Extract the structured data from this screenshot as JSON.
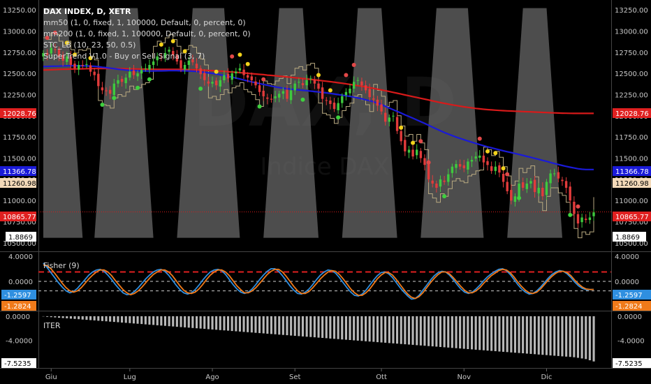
{
  "header": {
    "title": "DAX INDEX, D, XETR",
    "watermark_symbol": "DAX, D",
    "watermark_name": "Indice DAX"
  },
  "legend": {
    "mm50": "mm50 (1, 0, fixed, 1, 100000, Default, 0, percent, 0)",
    "mm200": "mm200 (1, 0, fixed, 1, 100000, Default, 0, percent, 0)",
    "stc": "STC_LB (10, 23, 50, 0.5)",
    "supertrend": "SuperTrend V1.0 - Buy or Sell Signal (3, 7)",
    "fisher": "Fisher (9)",
    "iter": "ITER"
  },
  "colors": {
    "background": "#000000",
    "candle_up": "#3ec93e",
    "candle_down": "#e23b3b",
    "ma50": "#1a1ad8",
    "ma200": "#d81a1a",
    "stc_fill": "#6e6e6e",
    "supertrend": "#b8a980",
    "fisher_main": "#2f8fe0",
    "fisher_signal": "#f07a1a",
    "fisher_dash_upper": "#e02020",
    "dot_yellow": "#f3d21a",
    "dot_red": "#e24848",
    "dot_green": "#3ed03e",
    "iter_bar": "#b8b8b8"
  },
  "badges": {
    "last_price": "10865.77",
    "ma200": "12028.76",
    "ma50": "11366.78",
    "supertrend": "11260.98",
    "stc": "1.8869",
    "fisher_main": "-1.2597",
    "fisher_signal": "-1.2824",
    "iter": "-7.5235"
  },
  "chart_data": [
    {
      "type": "candlestick",
      "title": "DAX INDEX, D, XETR",
      "x_tick_labels": [
        "Giu",
        "Lug",
        "Ago",
        "Set",
        "Ott",
        "Nov",
        "Dic"
      ],
      "y_tick_labels": [
        "13250.00",
        "13000.00",
        "12750.00",
        "12500.00",
        "12250.00",
        "12000.00",
        "11750.00",
        "11500.00",
        "11250.00",
        "11000.00",
        "10750.00",
        "10500.00"
      ],
      "ylim": [
        10450,
        13300
      ],
      "close": [
        12740,
        12720,
        12800,
        12780,
        12700,
        12650,
        12700,
        12600,
        12560,
        12600,
        12590,
        12610,
        12520,
        12480,
        12350,
        12300,
        12290,
        12260,
        12380,
        12420,
        12400,
        12450,
        12520,
        12480,
        12500,
        12540,
        12560,
        12600,
        12640,
        12700,
        12680,
        12740,
        12780,
        12720,
        12640,
        12560,
        12600,
        12650,
        12630,
        12560,
        12490,
        12420,
        12380,
        12400,
        12360,
        12420,
        12480,
        12440,
        12500,
        12520,
        12560,
        12480,
        12450,
        12420,
        12360,
        12280,
        12230,
        12200,
        12190,
        12230,
        12260,
        12290,
        12200,
        12300,
        12380,
        12400,
        12360,
        12420,
        12440,
        12380,
        12320,
        12200,
        12180,
        12140,
        12080,
        12150,
        12230,
        12280,
        12320,
        12400,
        12420,
        12360,
        12300,
        12220,
        12190,
        12120,
        12050,
        11930,
        11980,
        12000,
        11820,
        11700,
        11580,
        11600,
        11520,
        11600,
        11500,
        11420,
        11250,
        11200,
        11150,
        11250,
        11220,
        11310,
        11400,
        11430,
        11400,
        11380,
        11460,
        11480,
        11520,
        11530,
        11450,
        11420,
        11350,
        11400,
        11330,
        11220,
        11110,
        11000,
        11050,
        11200,
        11150,
        11200,
        11230,
        11100,
        11150,
        11050,
        11220,
        11320,
        11320,
        11260,
        11230,
        11150,
        11000,
        10840,
        10730,
        10800,
        10770,
        10800,
        10860
      ],
      "ma50": [
        12580,
        12582,
        12584,
        12585,
        12586,
        12588,
        12589,
        12590,
        12590,
        12590,
        12589,
        12588,
        12586,
        12583,
        12579,
        12573,
        12568,
        12562,
        12556,
        12550,
        12545,
        12540,
        12537,
        12534,
        12531,
        12530,
        12529,
        12528,
        12529,
        12530,
        12530,
        12531,
        12532,
        12532,
        12532,
        12531,
        12530,
        12529,
        12526,
        12523,
        12518,
        12512,
        12506,
        12500,
        12492,
        12484,
        12475,
        12466,
        12456,
        12445,
        12434,
        12422,
        12411,
        12400,
        12390,
        12380,
        12370,
        12360,
        12350,
        12341,
        12333,
        12326,
        12320,
        12314,
        12309,
        12305,
        12300,
        12296,
        12291,
        12286,
        12281,
        12275,
        12270,
        12264,
        12257,
        12250,
        12243,
        12236,
        12228,
        12219,
        12210,
        12200,
        12189,
        12178,
        12165,
        12150,
        12132,
        12112,
        12092,
        12072,
        12052,
        12032,
        12011,
        11991,
        11971,
        11951,
        11931,
        11910,
        11888,
        11866,
        11844,
        11823,
        11803,
        11784,
        11766,
        11749,
        11733,
        11718,
        11703,
        11688,
        11674,
        11660,
        11647,
        11634,
        11622,
        11610,
        11598,
        11587,
        11576,
        11566,
        11555,
        11544,
        11533,
        11521,
        11510,
        11498,
        11486,
        11474,
        11462,
        11449,
        11437,
        11425,
        11414,
        11403,
        11393,
        11384,
        11375,
        11369,
        11366,
        11366,
        11366
      ],
      "ma200": [
        12540,
        12541,
        12543,
        12545,
        12547,
        12549,
        12550,
        12551,
        12552,
        12553,
        12554,
        12555,
        12556,
        12557,
        12557,
        12557,
        12557,
        12557,
        12556,
        12556,
        12555,
        12554,
        12553,
        12553,
        12552,
        12551,
        12550,
        12550,
        12549,
        12548,
        12548,
        12548,
        12548,
        12548,
        12548,
        12547,
        12546,
        12545,
        12544,
        12542,
        12540,
        12538,
        12535,
        12533,
        12530,
        12527,
        12524,
        12520,
        12517,
        12513,
        12509,
        12505,
        12501,
        12497,
        12493,
        12489,
        12485,
        12480,
        12476,
        12472,
        12467,
        12463,
        12458,
        12454,
        12449,
        12444,
        12439,
        12434,
        12429,
        12424,
        12419,
        12413,
        12408,
        12402,
        12396,
        12390,
        12384,
        12377,
        12370,
        12363,
        12356,
        12348,
        12340,
        12332,
        12323,
        12314,
        12305,
        12296,
        12286,
        12276,
        12266,
        12256,
        12246,
        12236,
        12226,
        12216,
        12206,
        12196,
        12186,
        12176,
        12166,
        12156,
        12147,
        12138,
        12129,
        12121,
        12113,
        12106,
        12099,
        12093,
        12087,
        12082,
        12077,
        12073,
        12069,
        12066,
        12063,
        12060,
        12058,
        12056,
        12054,
        12052,
        12050,
        12048,
        12046,
        12044,
        12042,
        12040,
        12038,
        12036,
        12034,
        12032,
        12031,
        12030,
        12029,
        12028,
        12028,
        12028,
        12028,
        12028,
        12028
      ]
    },
    {
      "type": "line",
      "title": "Fisher (9)",
      "y_tick_labels": [
        "4.0000",
        "0.0000",
        "-4.0000"
      ],
      "ylim": [
        -4.3,
        4.2
      ],
      "reference_lines": [
        1.5,
        0,
        -1.5
      ],
      "series": [
        {
          "name": "Fisher",
          "values": [
            2.9,
            2.2,
            1.4,
            0.6,
            -0.2,
            -0.9,
            -1.5,
            -1.8,
            -1.6,
            -1.1,
            -0.4,
            0.3,
            1.0,
            1.5,
            1.8,
            1.9,
            1.6,
            1.0,
            0.3,
            -0.5,
            -1.2,
            -1.8,
            -2.1,
            -2.0,
            -1.6,
            -1.0,
            -0.3,
            0.4,
            1.0,
            1.5,
            1.8,
            1.9,
            1.6,
            1.0,
            0.2,
            -0.6,
            -1.3,
            -1.8,
            -2.0,
            -1.8,
            -1.3,
            -0.6,
            0.2,
            0.9,
            1.5,
            1.8,
            1.9,
            1.7,
            1.1,
            0.3,
            -0.5,
            -1.2,
            -1.7,
            -1.9,
            -1.7,
            -1.2,
            -0.5,
            0.3,
            1.0,
            1.6,
            2.0,
            2.0,
            1.6,
            0.9,
            0.1,
            -0.7,
            -1.4,
            -1.9,
            -2.0,
            -1.7,
            -1.2,
            -0.5,
            0.3,
            1.0,
            1.5,
            1.8,
            1.7,
            1.3,
            0.6,
            -0.2,
            -1.0,
            -1.7,
            -2.2,
            -2.3,
            -2.0,
            -1.4,
            -0.6,
            0.2,
            0.9,
            1.4,
            1.5,
            1.2,
            0.6,
            -0.2,
            -1.0,
            -1.7,
            -2.3,
            -2.8,
            -2.7,
            -2.2,
            -1.4,
            -0.6,
            0.2,
            0.9,
            1.4,
            1.6,
            1.5,
            1.0,
            0.3,
            -0.5,
            -1.2,
            -1.7,
            -1.9,
            -1.7,
            -1.2,
            -0.6,
            0.1,
            0.7,
            1.2,
            1.6,
            1.9,
            2.0,
            1.7,
            1.1,
            0.3,
            -0.5,
            -1.2,
            -1.7,
            -2.0,
            -1.9,
            -1.5,
            -0.9,
            -0.2,
            0.5,
            1.1,
            1.5,
            1.7,
            1.6,
            1.2,
            0.6,
            -0.1,
            -0.7,
            -1.1,
            -1.3,
            -1.3,
            -1.26
          ]
        },
        {
          "name": "Signal",
          "values": [
            2.6,
            2.5,
            2.0,
            1.3,
            0.5,
            -0.3,
            -1.0,
            -1.5,
            -1.7,
            -1.5,
            -1.0,
            -0.3,
            0.4,
            1.0,
            1.5,
            1.8,
            1.8,
            1.5,
            0.9,
            0.1,
            -0.6,
            -1.3,
            -1.8,
            -2.1,
            -1.9,
            -1.5,
            -0.9,
            -0.2,
            0.5,
            1.1,
            1.5,
            1.8,
            1.8,
            1.5,
            0.9,
            0.1,
            -0.7,
            -1.4,
            -1.8,
            -1.9,
            -1.7,
            -1.2,
            -0.5,
            0.3,
            1.0,
            1.5,
            1.8,
            1.8,
            1.5,
            0.9,
            0.1,
            -0.7,
            -1.3,
            -1.8,
            -1.8,
            -1.5,
            -1.0,
            -0.3,
            0.4,
            1.1,
            1.6,
            1.9,
            1.9,
            1.5,
            0.8,
            0.0,
            -0.8,
            -1.5,
            -1.9,
            -1.9,
            -1.6,
            -1.0,
            -0.3,
            0.4,
            1.0,
            1.5,
            1.7,
            1.6,
            1.1,
            0.4,
            -0.4,
            -1.2,
            -1.8,
            -2.2,
            -2.2,
            -1.8,
            -1.2,
            -0.4,
            0.4,
            1.0,
            1.4,
            1.4,
            1.0,
            0.3,
            -0.5,
            -1.3,
            -2.0,
            -2.5,
            -2.7,
            -2.4,
            -1.8,
            -1.0,
            -0.2,
            0.5,
            1.1,
            1.5,
            1.5,
            1.2,
            0.6,
            -0.1,
            -0.8,
            -1.4,
            -1.8,
            -1.8,
            -1.5,
            -1.0,
            -0.3,
            0.3,
            0.9,
            1.3,
            1.7,
            1.9,
            1.8,
            1.4,
            0.7,
            -0.1,
            -0.8,
            -1.4,
            -1.8,
            -1.9,
            -1.7,
            -1.2,
            -0.5,
            0.2,
            0.8,
            1.3,
            1.6,
            1.6,
            1.4,
            0.9,
            0.2,
            -0.4,
            -0.9,
            -1.2,
            -1.28,
            -1.28
          ]
        }
      ]
    },
    {
      "type": "bar",
      "title": "ITER",
      "y_tick_labels": [
        "0.0000",
        "-4.0000"
      ],
      "ylim": [
        -8.0,
        0.1
      ],
      "values": [
        -0.05,
        -0.1,
        -0.15,
        -0.2,
        -0.25,
        -0.3,
        -0.35,
        -0.4,
        -0.45,
        -0.5,
        -0.55,
        -0.6,
        -0.65,
        -0.7,
        -0.75,
        -0.8,
        -0.85,
        -0.9,
        -0.95,
        -1.0,
        -1.05,
        -1.1,
        -1.15,
        -1.2,
        -1.25,
        -1.3,
        -1.35,
        -1.4,
        -1.45,
        -1.5,
        -1.55,
        -1.6,
        -1.65,
        -1.7,
        -1.75,
        -1.8,
        -1.85,
        -1.9,
        -1.95,
        -2.0,
        -2.05,
        -2.1,
        -2.15,
        -2.2,
        -2.25,
        -2.3,
        -2.35,
        -2.4,
        -2.45,
        -2.5,
        -2.55,
        -2.6,
        -2.65,
        -2.7,
        -2.75,
        -2.8,
        -2.85,
        -2.9,
        -2.95,
        -3.0,
        -3.05,
        -3.1,
        -3.15,
        -3.2,
        -3.25,
        -3.3,
        -3.35,
        -3.4,
        -3.45,
        -3.5,
        -3.55,
        -3.6,
        -3.65,
        -3.7,
        -3.75,
        -3.8,
        -3.85,
        -3.9,
        -3.95,
        -4.0,
        -4.05,
        -4.1,
        -4.15,
        -4.2,
        -4.25,
        -4.3,
        -4.35,
        -4.4,
        -4.45,
        -4.5,
        -4.55,
        -4.6,
        -4.65,
        -4.7,
        -4.75,
        -4.8,
        -4.85,
        -4.9,
        -4.95,
        -5.0,
        -5.05,
        -5.1,
        -5.15,
        -5.2,
        -5.25,
        -5.3,
        -5.35,
        -5.4,
        -5.45,
        -5.5,
        -5.55,
        -5.6,
        -5.65,
        -5.7,
        -5.75,
        -5.8,
        -5.85,
        -5.9,
        -5.95,
        -6.0,
        -6.05,
        -6.1,
        -6.15,
        -6.2,
        -6.25,
        -6.3,
        -6.35,
        -6.4,
        -6.45,
        -6.5,
        -6.55,
        -6.6,
        -6.65,
        -6.7,
        -6.75,
        -6.8,
        -6.9,
        -7.0,
        -7.1,
        -7.3,
        -7.5
      ]
    }
  ]
}
